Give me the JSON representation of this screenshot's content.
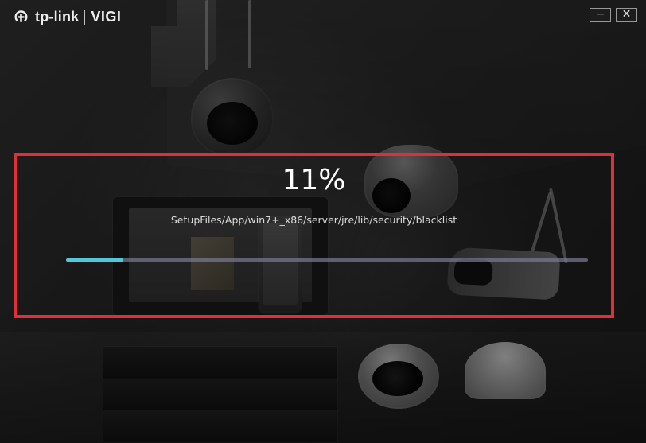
{
  "branding": {
    "logo_text": "tp-link",
    "product_name": "VIGI",
    "logo_icon": "tp-link-logo-icon"
  },
  "window_controls": {
    "minimize_label": "−",
    "close_label": "✕",
    "minimize_icon": "minimize-icon",
    "close_icon": "close-icon"
  },
  "progress": {
    "percent_text": "11%",
    "percent_value": 11,
    "file_path": "SetupFiles/App/win7+_x86/server/jre/lib/security/blacklist"
  },
  "colors": {
    "accent": "#53c7d9",
    "highlight_border": "#e02f39",
    "text": "#ffffff"
  }
}
